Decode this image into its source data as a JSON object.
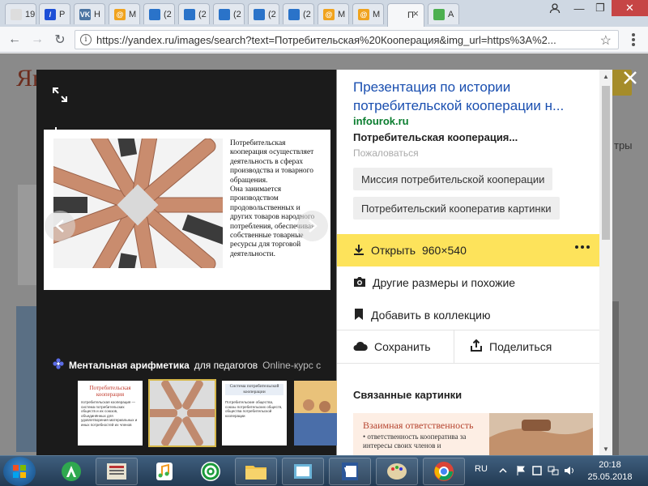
{
  "browser": {
    "tabs": [
      {
        "label": "19",
        "icon": "page-icon",
        "color": "#dddddd"
      },
      {
        "label": "Р",
        "icon": "slash-icon",
        "color": "#1d4fd6"
      },
      {
        "label": "Н",
        "icon": "vk-icon",
        "color": "#4c75a3"
      },
      {
        "label": "М",
        "icon": "at-icon",
        "color": "#f0a31e"
      },
      {
        "label": "(2",
        "icon": "presentation-icon",
        "color": "#2a73c9"
      },
      {
        "label": "(2",
        "icon": "presentation-icon",
        "color": "#2a73c9"
      },
      {
        "label": "(2",
        "icon": "presentation-icon",
        "color": "#2a73c9"
      },
      {
        "label": "(2",
        "icon": "presentation-icon",
        "color": "#2a73c9"
      },
      {
        "label": "(2",
        "icon": "presentation-icon",
        "color": "#2a73c9"
      },
      {
        "label": "М",
        "icon": "at-icon",
        "color": "#f0a31e"
      },
      {
        "label": "М",
        "icon": "at-icon",
        "color": "#f0a31e"
      },
      {
        "label": "П",
        "icon": "none",
        "color": "#ffffff"
      },
      {
        "label": "А",
        "icon": "green-square-icon",
        "color": "#4caf50"
      }
    ],
    "url": "https://yandex.ru/images/search?text=Потребительская%20Кооперация&img_url=https%3A%2..."
  },
  "viewer": {
    "slide_text": "Потребительская\nкооперация осуществляет\nдеятельность в сферах\nпроизводства и товарного\nобращения.\nОна занимается\nпроизводством\nпродовольственных и\nдругих товаров народного\nпотребления, обеспечивая\nсобственные товарные\nресурсы для торговой\nдеятельности.",
    "promo_bold": "Ментальная арифметика",
    "promo_normal": "для педагогов",
    "promo_muted": "Online-курс с",
    "thumbs": [
      {
        "title": "Потребительская кооперация",
        "text": "потребительская кооперация — система потребительских обществ и их союзов, объединённых для удовлетворения материальных и иных потребностей их членов"
      },
      {
        "title": "",
        "text": ""
      },
      {
        "title": "Система потребительской кооперации",
        "text": "Потребительские общества, союзы потребительских обществ, общества потребительской кооперации"
      },
      {
        "title": "",
        "text": ""
      }
    ]
  },
  "panel": {
    "title": "Презентация по истории потребительской кооперации н...",
    "domain": "infourok.ru",
    "description": "Потребительская кооперация...",
    "complain": "Пожаловаться",
    "chips": [
      "Миссия потребительской кооперации",
      "Потребительский кооператив картинки"
    ],
    "open_label": "Открыть",
    "open_size": "960×540",
    "other_sizes": "Другие размеры и похожие",
    "add_collection": "Добавить в коллекцию",
    "save": "Сохранить",
    "share": "Поделиться",
    "related_heading": "Связанные картинки",
    "related_title": "Взаимная ответственность",
    "related_text": "• ответственность кооператива за интересы своих членов и"
  },
  "page": {
    "logo": "Ян",
    "right_text": "тры"
  },
  "taskbar": {
    "lang": "RU",
    "time": "20:18",
    "date": "25.05.2018"
  },
  "colors": {
    "accent": "#fde35b",
    "link": "#1a4fb0",
    "domain": "#0a7d2f"
  }
}
